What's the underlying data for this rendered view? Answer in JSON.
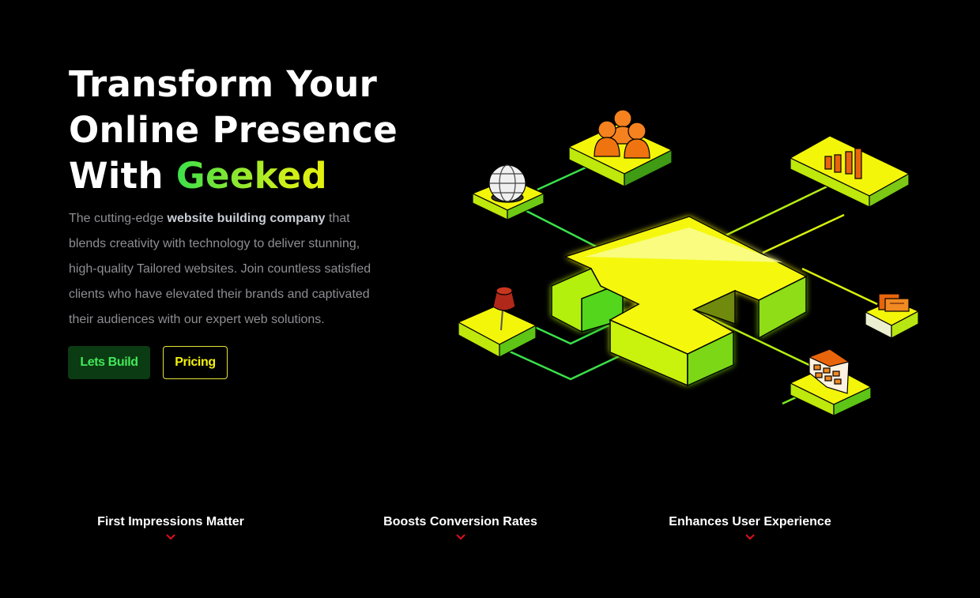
{
  "hero": {
    "title_line1": "Transform Your",
    "title_line2": "Online Presence",
    "title_line3_prefix": "With ",
    "title_brand": "Geeked",
    "desc_part1": "The cutting-edge ",
    "desc_bold": "website building company",
    "desc_part2": " that blends creativity with technology to deliver stunning, high-quality Tailored websites. Join countless satisfied clients who have elevated their brands and captivated their audiences with our expert web solutions.",
    "build_button": "Lets Build",
    "pricing_button": "Pricing"
  },
  "features": [
    {
      "title": "First Impressions Matter"
    },
    {
      "title": "Boosts Conversion Rates"
    },
    {
      "title": "Enhances User Experience"
    }
  ],
  "colors": {
    "background": "#000000",
    "brand_green": "#3be04a",
    "brand_yellow": "#f2f00e",
    "chevron_red": "#e0101a"
  },
  "icons": [
    "globe-icon",
    "users-icon",
    "bar-chart-icon",
    "pin-icon",
    "calendar-icon",
    "folder-icon",
    "chevron-down-icon"
  ]
}
